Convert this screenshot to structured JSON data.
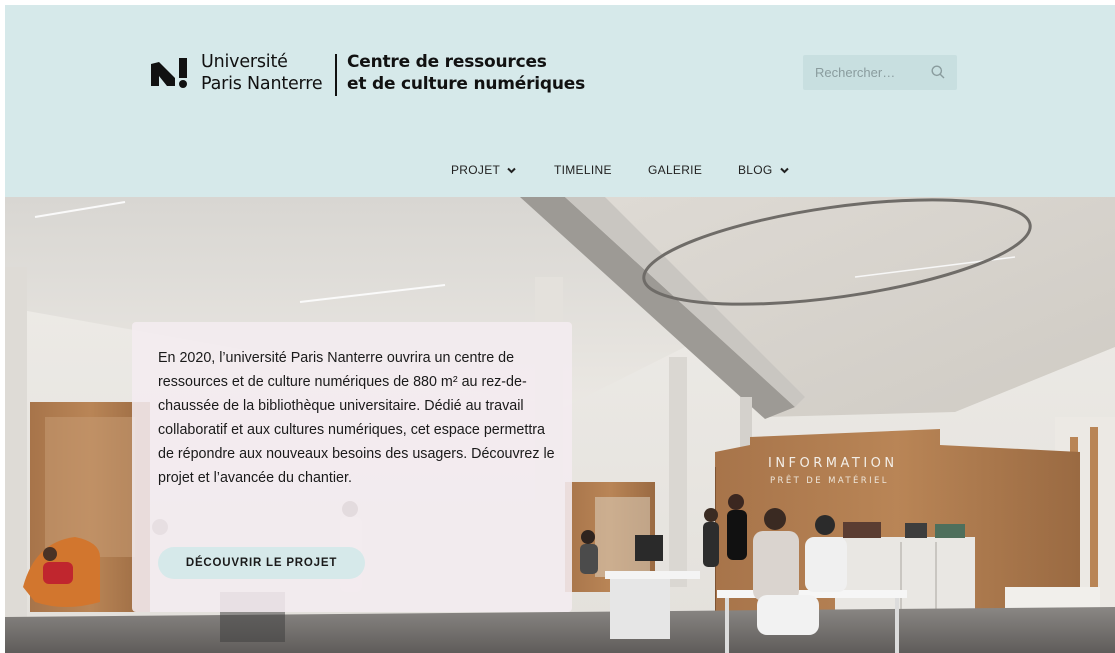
{
  "header": {
    "logo": {
      "university_line1": "Université",
      "university_line2": "Paris Nanterre",
      "centre_line1": "Centre de ressources",
      "centre_line2": "et de culture numériques"
    },
    "search": {
      "placeholder": "Rechercher…",
      "icon": "search-icon"
    },
    "nav": [
      {
        "label": "PROJET",
        "has_dropdown": true
      },
      {
        "label": "TIMELINE",
        "has_dropdown": false
      },
      {
        "label": "GALERIE",
        "has_dropdown": false
      },
      {
        "label": "BLOG",
        "has_dropdown": true
      }
    ]
  },
  "hero": {
    "text": "En 2020, l’université Paris Nanterre ouvrira un centre de ressources et de culture numériques de 880 m² au rez-de-chaussée de la bibliothèque universitaire. Dédié au travail collaboratif et aux cultures numériques, cet espace permettra de répondre aux nouveaux besoins des usagers. Découvrez le projet et l’avancée du chantier.",
    "button_label": "DÉCOUVRIR LE PROJET",
    "scene_sign": "INFORMATION",
    "scene_sign_sub": "PRÊT DE MATÉRIEL"
  },
  "colors": {
    "header_bg": "#d6e9ea",
    "search_bg": "#c8dfe0",
    "card_bg": "#f4ecf0",
    "button_bg": "#d6e9ea",
    "text": "#1a1a1a"
  }
}
